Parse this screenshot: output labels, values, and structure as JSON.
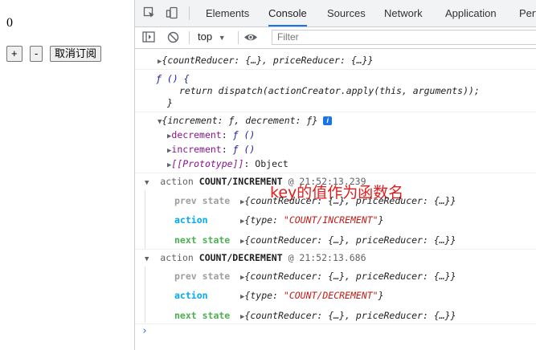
{
  "app": {
    "count": "0",
    "plus_label": "+",
    "minus_label": "-",
    "unsubscribe_label": "取消订阅"
  },
  "devtools": {
    "tabs": [
      "Elements",
      "Console",
      "Sources",
      "Network",
      "Application",
      "Perf"
    ],
    "active_tab": "Console",
    "context": "top",
    "filter_placeholder": "Filter",
    "accent": "#1a73e8"
  },
  "console": {
    "l1": "{countReducer: {…}, priceReducer: {…}}",
    "f_open": "ƒ () {",
    "f_body": "return dispatch(actionCreator.apply(this, arguments));",
    "f_close": "}",
    "obj_summary": "{increment: ƒ, decrement: ƒ}",
    "decrement_key": "decrement",
    "decrement_val": "ƒ ()",
    "increment_key": "increment",
    "increment_val": "ƒ ()",
    "proto_key": "[[Prototype]]",
    "proto_val": "Object",
    "annotation": "key的值作为函数名",
    "groups": [
      {
        "title_prefix": "action",
        "type": "COUNT/INCREMENT",
        "time": "@ 21:52:13.239",
        "prev_label": "prev state",
        "prev_val": "{countReducer: {…}, priceReducer: {…}}",
        "action_label": "action",
        "action_val_pre": "{type: ",
        "action_val_str": "\"COUNT/INCREMENT\"",
        "action_val_post": "}",
        "next_label": "next state",
        "next_val": "{countReducer: {…}, priceReducer: {…}}"
      },
      {
        "title_prefix": "action",
        "type": "COUNT/DECREMENT",
        "time": "@ 21:52:13.686",
        "prev_label": "prev state",
        "prev_val": "{countReducer: {…}, priceReducer: {…}}",
        "action_label": "action",
        "action_val_pre": "{type: ",
        "action_val_str": "\"COUNT/DECREMENT\"",
        "action_val_post": "}",
        "next_label": "next state",
        "next_val": "{countReducer: {…}, priceReducer: {…}}"
      }
    ],
    "prompt": "›"
  }
}
